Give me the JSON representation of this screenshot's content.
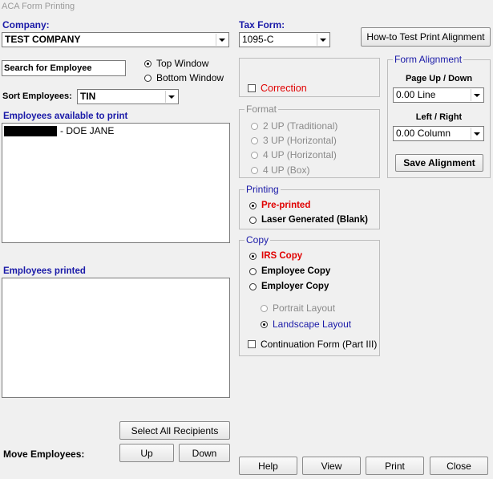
{
  "window": {
    "title": "ACA Form Printing"
  },
  "company": {
    "label": "Company:",
    "value": "TEST COMPANY"
  },
  "tax_form": {
    "label": "Tax Form:",
    "value": "1095-C"
  },
  "how_to_button": "How-to Test Print Alignment",
  "search": {
    "value": "Search for Employee"
  },
  "window_position": {
    "top": "Top Window",
    "bottom": "Bottom Window"
  },
  "sort": {
    "label": "Sort Employees:",
    "value": "TIN"
  },
  "available": {
    "label": "Employees available to print",
    "items": [
      {
        "name": "- DOE JANE"
      }
    ]
  },
  "printed": {
    "label": "Employees printed"
  },
  "correction": {
    "label": "Correction"
  },
  "format": {
    "title": "Format",
    "options": [
      "2 UP (Traditional)",
      "3 UP (Horizontal)",
      "4 UP (Horizontal)",
      "4 UP (Box)"
    ]
  },
  "printing": {
    "title": "Printing",
    "options": [
      "Pre-printed",
      "Laser Generated (Blank)"
    ]
  },
  "copy": {
    "title": "Copy",
    "options": [
      "IRS Copy",
      "Employee Copy",
      "Employer Copy"
    ],
    "layouts": [
      "Portrait Layout",
      "Landscape Layout"
    ],
    "continuation": "Continuation Form (Part III)"
  },
  "alignment": {
    "title": "Form Alignment",
    "page_label": "Page Up / Down",
    "page_value": "0.00 Line",
    "lr_label": "Left / Right",
    "lr_value": "0.00 Column",
    "save": "Save  Alignment"
  },
  "move": {
    "label": "Move Employees:",
    "select_all": "Select  All Recipients",
    "up": "Up",
    "down": "Down"
  },
  "footer": {
    "help": "Help",
    "view": "View",
    "print": "Print",
    "close": "Close"
  },
  "colors": {
    "blue_label": "#1a1aa8",
    "red_text": "#e00000",
    "disabled": "#8a8a8a"
  }
}
